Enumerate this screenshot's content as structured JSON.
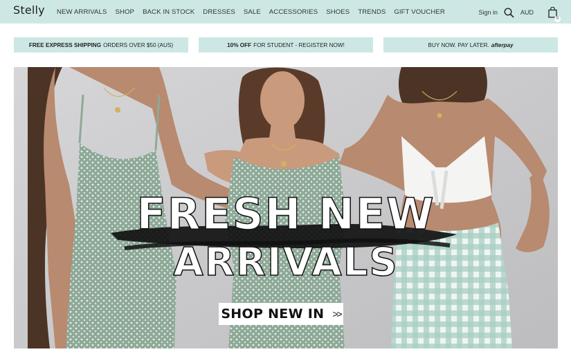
{
  "brand": {
    "logo": "Stelly"
  },
  "nav": {
    "items": [
      "NEW ARRIVALS",
      "SHOP",
      "BACK IN STOCK",
      "DRESSES",
      "SALE",
      "ACCESSORIES",
      "SHOES",
      "TRENDS",
      "GIFT VOUCHER"
    ]
  },
  "tools": {
    "sign_in": "Sign in",
    "currency": "AUD",
    "cart_count": "0",
    "search_icon": "search-icon",
    "bag_icon": "shopping-bag-icon"
  },
  "promos": [
    {
      "bold": "FREE EXPRESS SHIPPING",
      "text": "ORDERS OVER $50 (AUS)"
    },
    {
      "bold": "10% OFF",
      "text": "FOR STUDENT - REGISTER NOW!"
    },
    {
      "bold": "",
      "text": "BUY NOW. PAY LATER.",
      "brand": "afterpay"
    }
  ],
  "hero": {
    "headline_line1": "FRESH NEW",
    "headline_line2": "ARRIVALS",
    "cta_label": "SHOP NEW IN",
    "cta_arrows": ">>"
  },
  "colors": {
    "topbar": "#cde8e4",
    "promo_bg": "#cde8e4",
    "hero_bg": "#cfcfd0",
    "text": "#333333"
  }
}
